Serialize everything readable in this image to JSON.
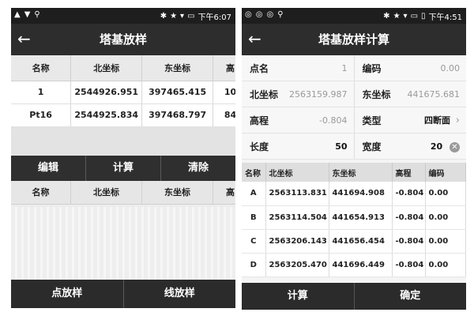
{
  "left": {
    "status": {
      "icons_left": [
        "▲",
        "▼",
        "⚲"
      ],
      "icons_right": [
        "✱",
        "★",
        "▾",
        "▭"
      ],
      "time": "下午6:07"
    },
    "title": "塔基放样",
    "table": {
      "headers": [
        "名称",
        "北坐标",
        "东坐标",
        "高"
      ],
      "rows": [
        [
          "1",
          "2544926.951",
          "397465.415",
          "10"
        ],
        [
          "Pt16",
          "2544925.834",
          "397468.797",
          "84"
        ]
      ]
    },
    "actions": [
      "编辑",
      "计算",
      "清除"
    ],
    "result_headers": [
      "名称",
      "北坐标",
      "东坐标",
      "高"
    ],
    "footer": [
      "点放样",
      "线放样"
    ]
  },
  "right": {
    "status": {
      "icons_left": [
        "◎",
        "◎",
        "◎",
        "⚲"
      ],
      "icons_right": [
        "✱",
        "★",
        "▾",
        "▭",
        "▯"
      ],
      "time": "下午4:51"
    },
    "title": "塔基放样计算",
    "form": {
      "name_label": "点名",
      "name_value": "1",
      "code_label": "编码",
      "code_value": "0.00",
      "north_label": "北坐标",
      "north_value": "2563159.987",
      "east_label": "东坐标",
      "east_value": "441675.681",
      "elev_label": "高程",
      "elev_value": "-0.804",
      "type_label": "类型",
      "type_value": "四断面",
      "length_label": "长度",
      "length_value": "50",
      "width_label": "宽度",
      "width_value": "20"
    },
    "table": {
      "headers": [
        "名称",
        "北坐标",
        "东坐标",
        "高程",
        "编码"
      ],
      "rows": [
        [
          "A",
          "2563113.831",
          "441694.908",
          "-0.804",
          "0.00"
        ],
        [
          "B",
          "2563114.504",
          "441654.913",
          "-0.804",
          "0.00"
        ],
        [
          "C",
          "2563206.143",
          "441656.454",
          "-0.804",
          "0.00"
        ],
        [
          "D",
          "2563205.470",
          "441696.449",
          "-0.804",
          "0.00"
        ]
      ]
    },
    "footer": [
      "计算",
      "确定"
    ]
  }
}
